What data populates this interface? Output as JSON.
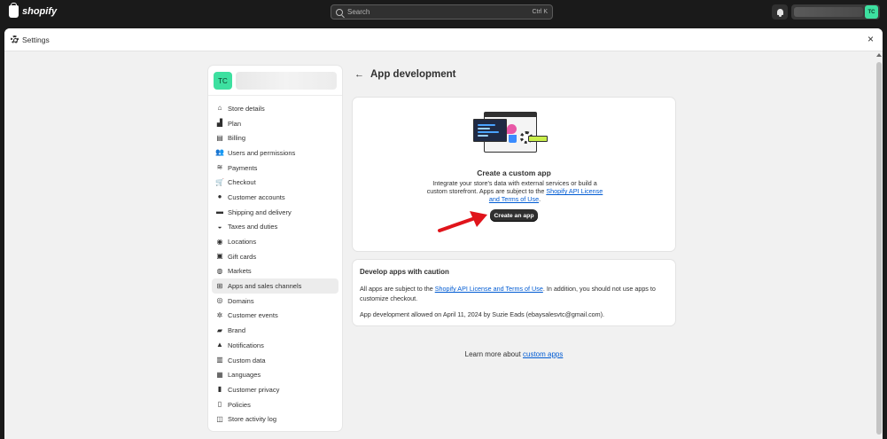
{
  "topbar": {
    "logo_text": "shopify",
    "search_placeholder": "Search",
    "search_shortcut": "Ctrl K",
    "avatar_initials": "TC"
  },
  "modal": {
    "title": "Settings",
    "close_glyph": "×"
  },
  "store": {
    "avatar_initials": "TC"
  },
  "sidebar": {
    "items": [
      {
        "label": "Store details",
        "icon": "store-icon",
        "glyph": "⌂"
      },
      {
        "label": "Plan",
        "icon": "plan-icon",
        "glyph": "▟"
      },
      {
        "label": "Billing",
        "icon": "billing-icon",
        "glyph": "▤"
      },
      {
        "label": "Users and permissions",
        "icon": "users-icon",
        "glyph": "👥"
      },
      {
        "label": "Payments",
        "icon": "payments-icon",
        "glyph": "≋"
      },
      {
        "label": "Checkout",
        "icon": "cart-icon",
        "glyph": "🛒"
      },
      {
        "label": "Customer accounts",
        "icon": "person-icon",
        "glyph": "●"
      },
      {
        "label": "Shipping and delivery",
        "icon": "truck-icon",
        "glyph": "▬"
      },
      {
        "label": "Taxes and duties",
        "icon": "tax-icon",
        "glyph": "◒"
      },
      {
        "label": "Locations",
        "icon": "location-icon",
        "glyph": "◉"
      },
      {
        "label": "Gift cards",
        "icon": "gift-icon",
        "glyph": "▣"
      },
      {
        "label": "Markets",
        "icon": "globe-icon",
        "glyph": "◍"
      },
      {
        "label": "Apps and sales channels",
        "icon": "apps-icon",
        "glyph": "⊞"
      },
      {
        "label": "Domains",
        "icon": "domain-icon",
        "glyph": "◎"
      },
      {
        "label": "Customer events",
        "icon": "events-icon",
        "glyph": "✲"
      },
      {
        "label": "Brand",
        "icon": "brand-icon",
        "glyph": "▰"
      },
      {
        "label": "Notifications",
        "icon": "bell-icon",
        "glyph": "▲"
      },
      {
        "label": "Custom data",
        "icon": "data-icon",
        "glyph": "▥"
      },
      {
        "label": "Languages",
        "icon": "language-icon",
        "glyph": "▦"
      },
      {
        "label": "Customer privacy",
        "icon": "lock-icon",
        "glyph": "▮"
      },
      {
        "label": "Policies",
        "icon": "policy-icon",
        "glyph": "▯"
      },
      {
        "label": "Store activity log",
        "icon": "log-icon",
        "glyph": "◫"
      }
    ],
    "active_index": 12
  },
  "page": {
    "title": "App development",
    "back_glyph": "←"
  },
  "custom_app_card": {
    "title": "Create a custom app",
    "desc_prefix": "Integrate your store's data with external services or build a custom storefront. Apps are subject to the ",
    "desc_link": "Shopify API License and Terms of Use",
    "desc_suffix": ".",
    "button_label": "Create an app"
  },
  "caution_card": {
    "title": "Develop apps with caution",
    "line1_prefix": "All apps are subject to the ",
    "line1_link": "Shopify API License and Terms of Use",
    "line1_suffix": ". In addition, you should not use apps to customize checkout.",
    "line2": "App development allowed on April 11, 2024 by Suzie Eads (ebaysalesvtc@gmail.com)."
  },
  "learn_more": {
    "prefix": "Learn more about ",
    "link": "custom apps"
  },
  "colors": {
    "accent_link": "#005bd3",
    "avatar": "#3de0a0",
    "arrow": "#e0141b"
  }
}
